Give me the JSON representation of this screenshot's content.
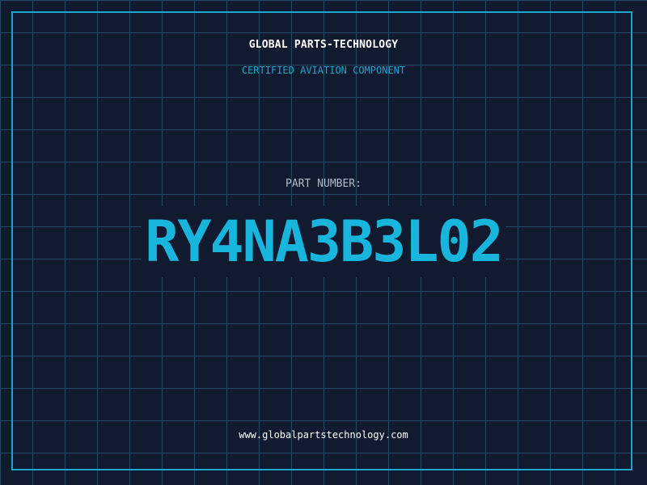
{
  "header": {
    "company": "GLOBAL PARTS-TECHNOLOGY",
    "subtitle": "CERTIFIED AVIATION COMPONENT"
  },
  "part": {
    "label": "PART NUMBER:",
    "number": "RY4NA3B3L02"
  },
  "footer": {
    "url": "www.globalpartstechnology.com"
  },
  "colors": {
    "background": "#121a2f",
    "grid": "#1f4a63",
    "accent": "#1aa7cf",
    "text": "#ffffff"
  }
}
